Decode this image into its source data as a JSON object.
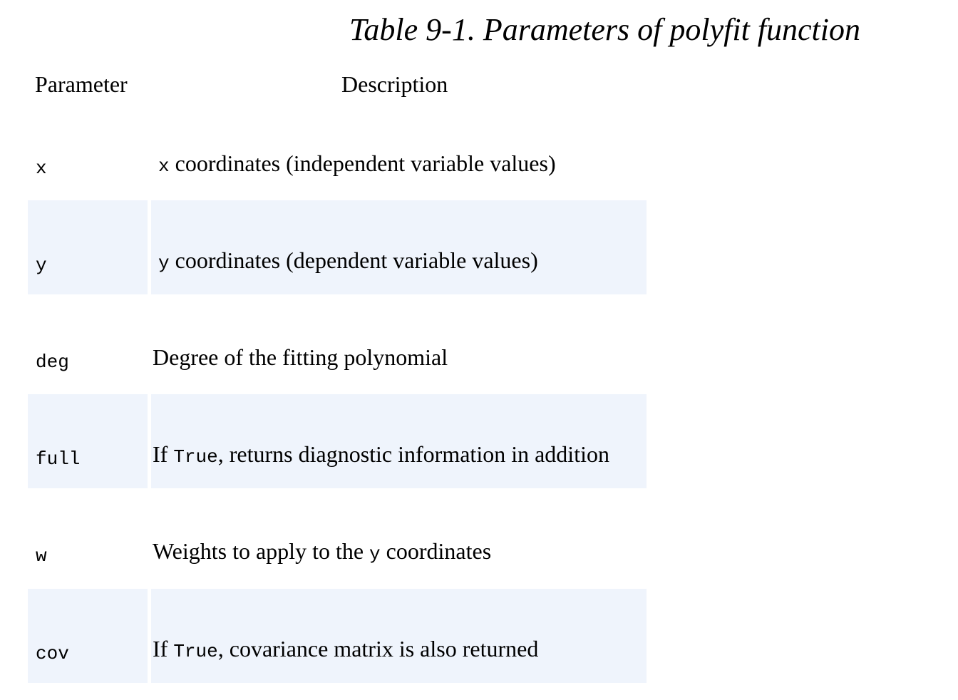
{
  "caption": "Table 9-1. Parameters of polyfit function",
  "headers": {
    "parameter": "Parameter",
    "description": "Description"
  },
  "rows": [
    {
      "param": "x",
      "desc_code_before": "x",
      "desc_prefix": "",
      "desc_code": "",
      "desc_suffix": " coordinates (independent variable values)"
    },
    {
      "param": "y",
      "desc_code_before": "y",
      "desc_prefix": "",
      "desc_code": "",
      "desc_suffix": " coordinates (dependent variable values)"
    },
    {
      "param": "deg",
      "desc_code_before": "",
      "desc_prefix": "Degree of the fitting polynomial",
      "desc_code": "",
      "desc_suffix": ""
    },
    {
      "param": "full",
      "desc_code_before": "",
      "desc_prefix": "If ",
      "desc_code": "True",
      "desc_suffix": ", returns diagnostic information in addition"
    },
    {
      "param": "w",
      "desc_code_before": "",
      "desc_prefix": "Weights to apply to the ",
      "desc_code": "y",
      "desc_suffix": " coordinates"
    },
    {
      "param": "cov",
      "desc_code_before": "",
      "desc_prefix": "If ",
      "desc_code": "True",
      "desc_suffix": ", covariance matrix is also returned"
    }
  ]
}
